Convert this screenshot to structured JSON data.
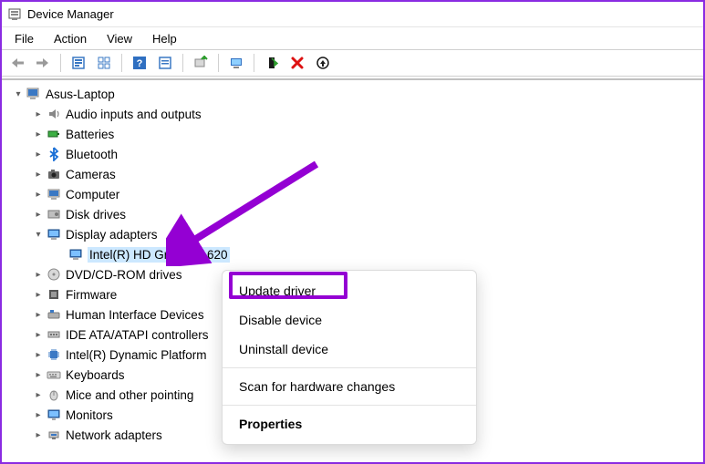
{
  "window": {
    "title": "Device Manager"
  },
  "menu": {
    "file": "File",
    "action": "Action",
    "view": "View",
    "help": "Help"
  },
  "tree": {
    "root": "Asus-Laptop",
    "items": [
      {
        "label": "Audio inputs and outputs"
      },
      {
        "label": "Batteries"
      },
      {
        "label": "Bluetooth"
      },
      {
        "label": "Cameras"
      },
      {
        "label": "Computer"
      },
      {
        "label": "Disk drives"
      },
      {
        "label": "Display adapters"
      },
      {
        "label": "DVD/CD-ROM drives"
      },
      {
        "label": "Firmware"
      },
      {
        "label": "Human Interface Devices"
      },
      {
        "label": "IDE ATA/ATAPI controllers"
      },
      {
        "label": "Intel(R) Dynamic Platform"
      },
      {
        "label": "Keyboards"
      },
      {
        "label": "Mice and other pointing"
      },
      {
        "label": "Monitors"
      },
      {
        "label": "Network adapters"
      }
    ],
    "gpu": "Intel(R) HD Graphics 620"
  },
  "context_menu": {
    "update": "Update driver",
    "disable": "Disable device",
    "uninstall": "Uninstall device",
    "scan": "Scan for hardware changes",
    "properties": "Properties"
  },
  "annotation": {
    "color": "#9400d3"
  }
}
